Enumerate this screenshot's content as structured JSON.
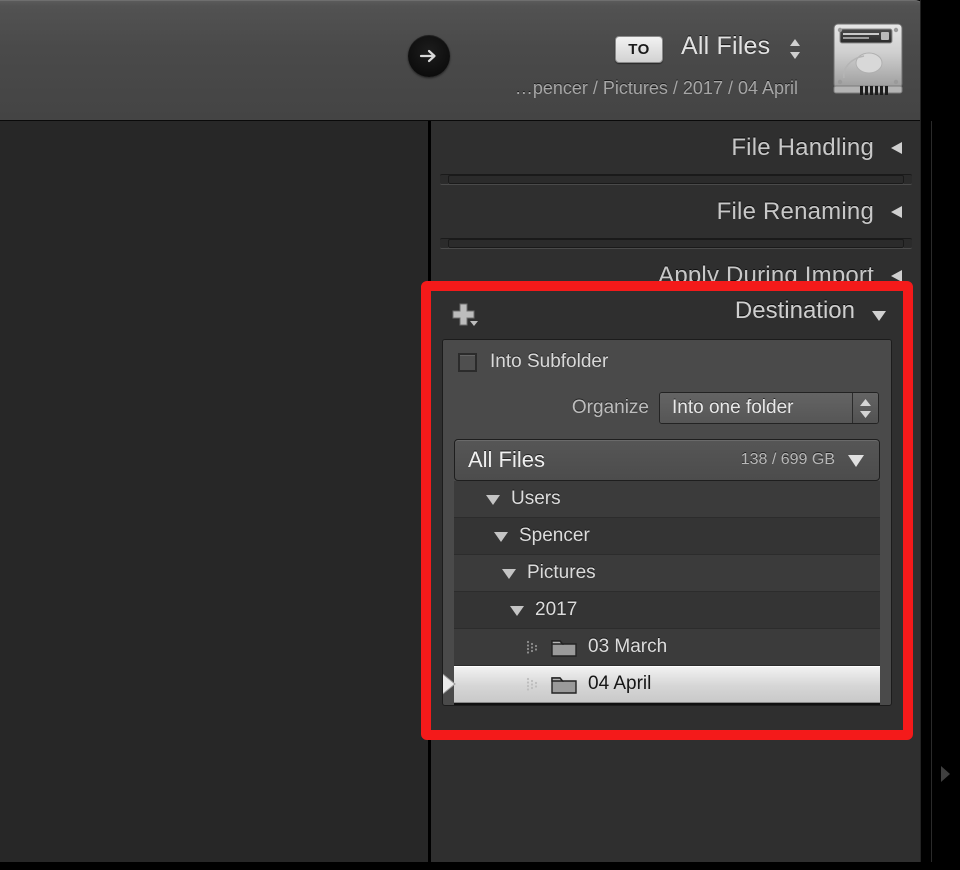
{
  "topbar": {
    "go_icon": "arrow-right-icon",
    "to_badge": "TO",
    "destination_name": "All Files",
    "destination_chevrons_icon": "chevron-updown-icon",
    "breadcrumb": "…pencer / Pictures / 2017 / 04 April",
    "drive_icon": "hard-drive-icon"
  },
  "panels": [
    {
      "title": "File Handling",
      "collapse_icon": "triangle-left-icon",
      "expanded": false
    },
    {
      "title": "File Renaming",
      "collapse_icon": "triangle-left-icon",
      "expanded": false
    },
    {
      "title": "Apply During Import",
      "collapse_icon": "triangle-left-icon",
      "expanded": false
    }
  ],
  "destination": {
    "title": "Destination",
    "add_icon": "plus-with-dropdown-icon",
    "collapse_icon": "triangle-down-icon",
    "into_subfolder": {
      "label": "Into Subfolder",
      "checked": false,
      "checkbox_icon": "checkbox-unchecked-icon"
    },
    "organize": {
      "label": "Organize",
      "value": "Into one folder",
      "stepper_icon": "stepper-updown-icon"
    },
    "volume": {
      "name": "All Files",
      "space": "138 / 699 GB",
      "disclosure_icon": "triangle-down-icon"
    },
    "tree": [
      {
        "label": "Users",
        "indent": 0,
        "icon": "triangle-down-icon",
        "kind": "disclosure",
        "selected": false
      },
      {
        "label": "Spencer",
        "indent": 1,
        "icon": "triangle-down-icon",
        "kind": "disclosure",
        "selected": false
      },
      {
        "label": "Pictures",
        "indent": 2,
        "icon": "triangle-down-icon",
        "kind": "disclosure",
        "selected": false
      },
      {
        "label": "2017",
        "indent": 3,
        "icon": "triangle-down-icon",
        "kind": "disclosure",
        "selected": false
      },
      {
        "label": "03 March",
        "indent": 4,
        "icon": "folder-icon",
        "kind": "folder",
        "selected": false
      },
      {
        "label": "04 April",
        "indent": 4,
        "icon": "folder-icon",
        "kind": "folder",
        "selected": true
      }
    ]
  },
  "right_strip": {
    "expand_icon": "triangle-right-icon"
  },
  "colors": {
    "highlight": "#f41a1a",
    "panel_bg": "#2f2f2f",
    "selected_row": "#e8e8e8"
  }
}
